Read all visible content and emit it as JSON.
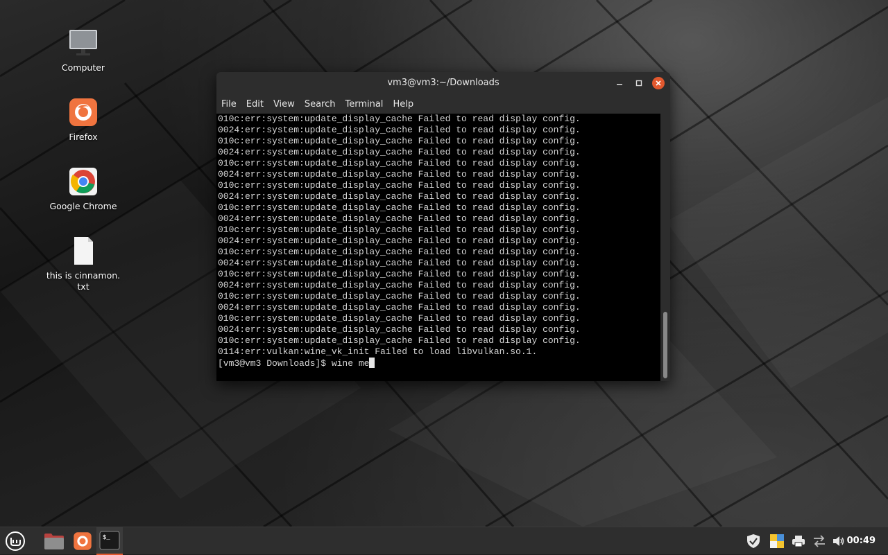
{
  "desktop": {
    "icons": [
      {
        "label": "Computer",
        "icon": "computer-icon"
      },
      {
        "label": "Firefox",
        "icon": "firefox-icon"
      },
      {
        "label": "Google Chrome",
        "icon": "chrome-icon"
      },
      {
        "label_line1": "this is cinnamon.",
        "label_line2": "txt",
        "icon": "text-file-icon"
      }
    ]
  },
  "terminal": {
    "title": "vm3@vm3:~/Downloads",
    "menu": [
      "File",
      "Edit",
      "View",
      "Search",
      "Terminal",
      "Help"
    ],
    "lines": [
      "010c:err:system:update_display_cache Failed to read display config.",
      "0024:err:system:update_display_cache Failed to read display config.",
      "010c:err:system:update_display_cache Failed to read display config.",
      "0024:err:system:update_display_cache Failed to read display config.",
      "010c:err:system:update_display_cache Failed to read display config.",
      "0024:err:system:update_display_cache Failed to read display config.",
      "010c:err:system:update_display_cache Failed to read display config.",
      "0024:err:system:update_display_cache Failed to read display config.",
      "010c:err:system:update_display_cache Failed to read display config.",
      "0024:err:system:update_display_cache Failed to read display config.",
      "010c:err:system:update_display_cache Failed to read display config.",
      "0024:err:system:update_display_cache Failed to read display config.",
      "010c:err:system:update_display_cache Failed to read display config.",
      "0024:err:system:update_display_cache Failed to read display config.",
      "010c:err:system:update_display_cache Failed to read display config.",
      "0024:err:system:update_display_cache Failed to read display config.",
      "010c:err:system:update_display_cache Failed to read display config.",
      "0024:err:system:update_display_cache Failed to read display config.",
      "010c:err:system:update_display_cache Failed to read display config.",
      "0024:err:system:update_display_cache Failed to read display config.",
      "010c:err:system:update_display_cache Failed to read display config.",
      "0114:err:vulkan:wine_vk_init Failed to load libvulkan.so.1."
    ],
    "prompt": "[vm3@vm3 Downloads]$ ",
    "input": "wine me"
  },
  "taskbar": {
    "clock": "00:49",
    "launchers": [
      "mint-menu-icon",
      "folder-icon",
      "firefox-icon",
      "terminal-icon"
    ],
    "tray": [
      "shield-icon",
      "update-manager-icon",
      "printer-icon",
      "network-icon",
      "volume-icon"
    ]
  },
  "colors": {
    "accent": "#e2582e",
    "terminal_bg": "#000000",
    "terminal_fg": "#d6d6d6",
    "panel_bg": "#2e2e2e"
  }
}
